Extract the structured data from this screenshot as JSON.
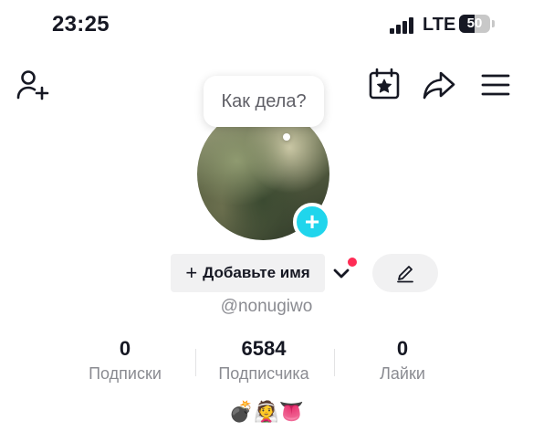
{
  "status_bar": {
    "time": "23:25",
    "network": "LTE",
    "battery_level": "50"
  },
  "header": {
    "icons": [
      "add-friend-icon",
      "calendar-star-icon",
      "share-icon",
      "menu-icon"
    ]
  },
  "profile": {
    "bubble_text": "Как дела?",
    "add_name_label": "Добавьте имя",
    "username": "@nonugiwo",
    "stats": [
      {
        "value": "0",
        "label": "Подписки"
      },
      {
        "value": "6584",
        "label": "Подписчика"
      },
      {
        "value": "0",
        "label": "Лайки"
      }
    ],
    "bio_emojis": [
      "💣",
      "👰",
      "👅"
    ]
  },
  "colors": {
    "accent_cyan": "#20d5ec",
    "notification_red": "#fe2c55",
    "text_primary": "#161823",
    "text_secondary": "#8a8b91"
  }
}
